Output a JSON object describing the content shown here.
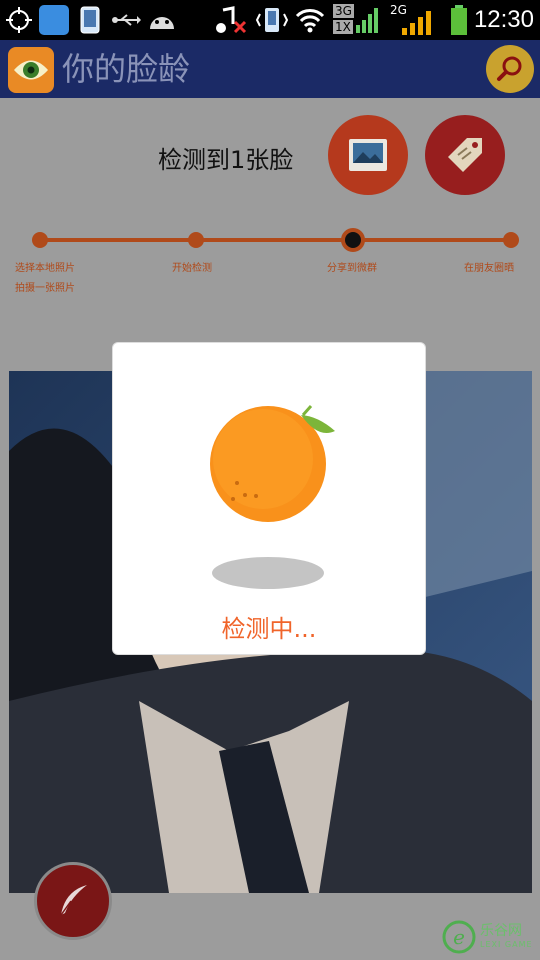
{
  "statusbar": {
    "network_3g": "3G",
    "network_1x": "1X",
    "network_2g": "2G",
    "time": "12:30"
  },
  "appbar": {
    "title": "你的脸龄"
  },
  "main": {
    "face_count_text": "检测到1张脸",
    "steps": [
      {
        "label": "选择本地照片"
      },
      {
        "label": "开始检测"
      },
      {
        "label": "分享到微群"
      },
      {
        "label": "在朋友圈晒"
      }
    ],
    "step_sublabel": "拍摄一张照片"
  },
  "dialog": {
    "status_text": "检测中..."
  },
  "watermark": {
    "name": "乐谷网",
    "sub": "LEXI GAME"
  },
  "colors": {
    "accent": "#f0642a",
    "appbar": "#1b2a66",
    "step_line": "#b04a1a"
  }
}
